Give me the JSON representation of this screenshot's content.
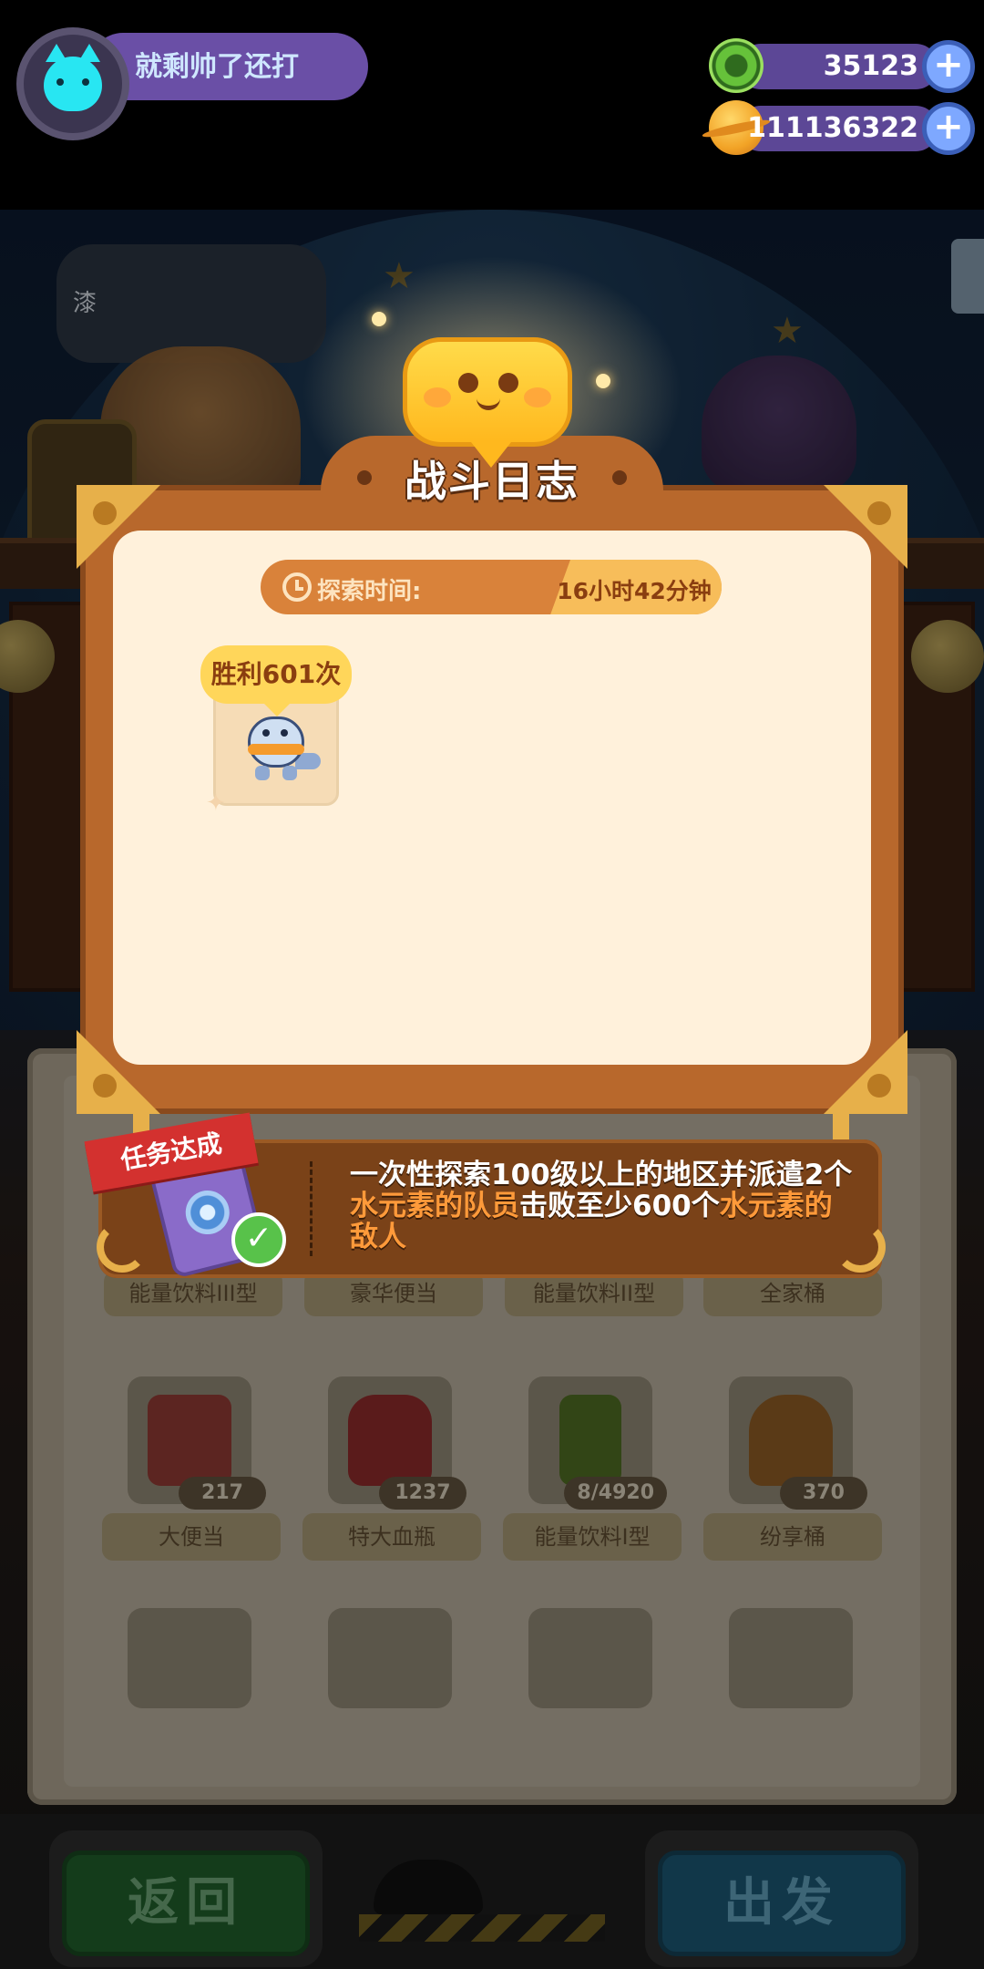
{
  "profile": {
    "player_name": "就剩帅了还打",
    "avatar_icon": "cyan-cat-avatar-icon"
  },
  "currencies": [
    {
      "icon": "green-donut-coin-icon",
      "value": "35123",
      "add_icon": "plus-icon"
    },
    {
      "icon": "gold-planet-coin-icon",
      "value": "111136322",
      "add_icon": "plus-icon"
    }
  ],
  "background": {
    "speech_text": "漆",
    "items_row1_labels": [
      "能量饮料III型",
      "豪华便当",
      "能量饮料II型",
      "全家桶"
    ],
    "items_row2": [
      {
        "label": "大便当",
        "count": "217",
        "icon": "bento-box-icon"
      },
      {
        "label": "特大血瓶",
        "count": "1237",
        "icon": "health-potion-icon"
      },
      {
        "label": "能量饮料I型",
        "count": "8/4920",
        "icon": "energy-drink-icon"
      },
      {
        "label": "纷享桶",
        "count": "370",
        "icon": "chicken-bucket-icon"
      }
    ],
    "return_button": "返回",
    "depart_button": "出发"
  },
  "dialog": {
    "title": "战斗日志",
    "emblem_icon": "smiling-chat-bubble-icon",
    "explore_time_label": "探索时间:",
    "explore_time_value": "16小时42分钟",
    "result": {
      "badge": "胜利601次",
      "icon": "blue-dinosaur-icon"
    }
  },
  "mission": {
    "ribbon": "任务达成",
    "card_icon": "water-element-card-icon",
    "check_icon": "check-icon",
    "text_1": "一次性探索100级以上的地区并派遣2个",
    "text_hl1": "水元素的队员",
    "text_2": "击败至少600个",
    "text_hl2": "水元素的敌人"
  },
  "colors": {
    "dialog_frame": "#b8682c",
    "dialog_inner": "#fff1db",
    "highlight_orange": "#ff9a3a",
    "ribbon_red": "#d3312f",
    "currency_pill": "#5c4796"
  }
}
